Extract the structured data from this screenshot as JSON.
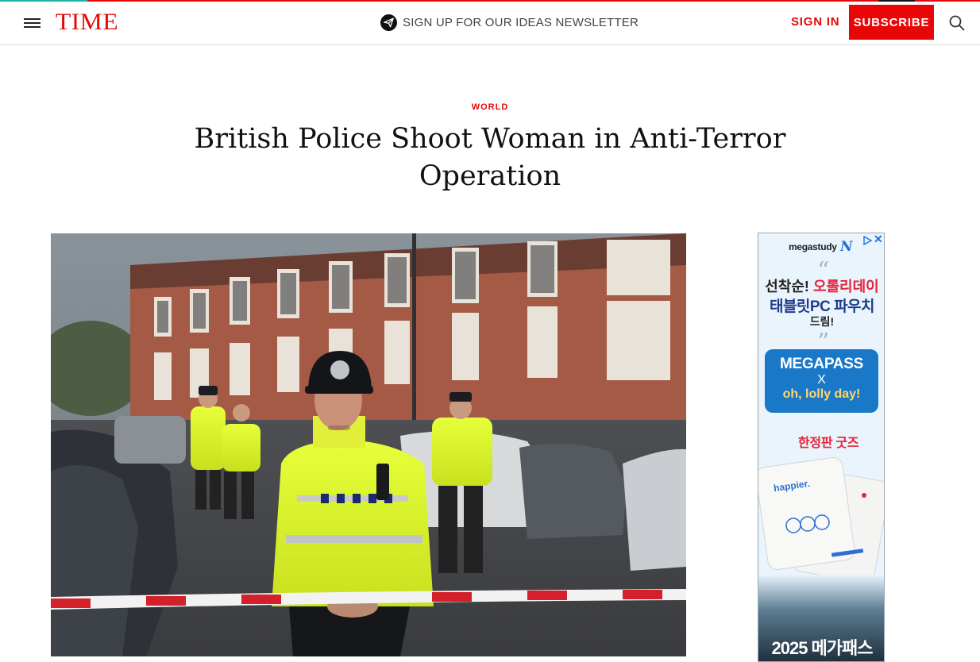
{
  "brand": {
    "logo_text": "TIME",
    "accent_color": "#e90606"
  },
  "header": {
    "menu_icon": "hamburger-menu-icon",
    "newsletter_icon": "send-icon",
    "newsletter_label": "SIGN UP FOR OUR IDEAS NEWSLETTER",
    "sign_in_label": "SIGN IN",
    "subscribe_label": "SUBSCRIBE",
    "search_icon": "search-icon"
  },
  "article": {
    "section": "WORLD",
    "headline": "British Police Shoot Woman in Anti-Terror Operation",
    "hero_image_subject": "police officer in high-visibility jacket standing behind police cordon tape on residential street"
  },
  "ad": {
    "brand": "megastudy",
    "brand_mark": "N",
    "choice_icon": "adchoices-icon",
    "close_icon": "close-icon",
    "line1_prefix": "선착순!",
    "line1_highlight": "오롤리데이",
    "line2": "태블릿PC 파우치",
    "line3": "드림!",
    "pass_title": "MEGAPASS",
    "pass_x": "X",
    "pass_partner": "oh, lolly day!",
    "limited_label": "한정판 굿즈",
    "pouch_text": "happier.",
    "bottom_text": "2025 메가패스"
  }
}
